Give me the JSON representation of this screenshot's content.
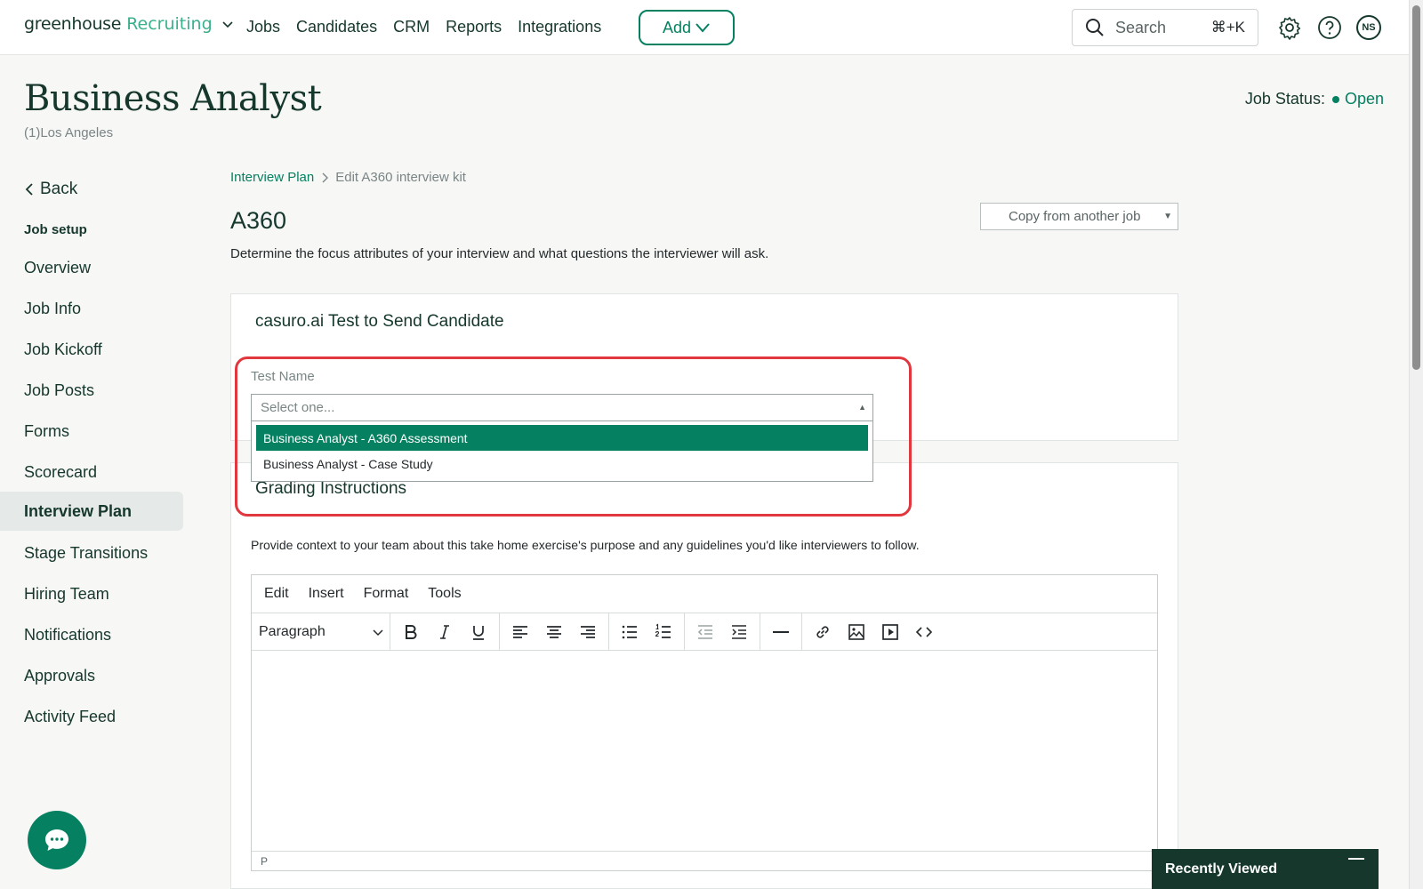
{
  "nav": {
    "brand_main": "greenhouse",
    "brand_sub": "Recruiting",
    "links": [
      "Jobs",
      "Candidates",
      "CRM",
      "Reports",
      "Integrations"
    ],
    "add_label": "Add",
    "search_placeholder": "Search",
    "search_shortcut": "⌘+K",
    "avatar_initials": "NS"
  },
  "header": {
    "title": "Business Analyst",
    "location": "(1)Los Angeles",
    "status_label": "Job Status:",
    "status_value": "Open"
  },
  "sidebar": {
    "back_label": "Back",
    "section_heading": "Job setup",
    "items": [
      {
        "label": "Overview"
      },
      {
        "label": "Job Info"
      },
      {
        "label": "Job Kickoff"
      },
      {
        "label": "Job Posts"
      },
      {
        "label": "Forms"
      },
      {
        "label": "Scorecard"
      },
      {
        "label": "Interview Plan"
      },
      {
        "label": "Stage Transitions"
      },
      {
        "label": "Hiring Team"
      },
      {
        "label": "Notifications"
      },
      {
        "label": "Approvals"
      },
      {
        "label": "Activity Feed"
      }
    ],
    "active_item": "Interview Plan"
  },
  "main": {
    "breadcrumb_link": "Interview Plan",
    "breadcrumb_current": "Edit A360 interview kit",
    "kit_title": "A360",
    "copy_select": "Copy from another job",
    "description": "Determine the focus attributes of your interview and what questions the interviewer will ask.",
    "test_card": {
      "heading": "casuro.ai Test to Send Candidate",
      "field_label": "Test Name",
      "placeholder": "Select one...",
      "options": [
        "Business Analyst - A360 Assessment",
        "Business Analyst - Case Study"
      ],
      "selected_option": "Business Analyst - A360 Assessment"
    },
    "grading": {
      "heading": "Grading Instructions",
      "text": "Provide context to your team about this take home exercise's purpose and any guidelines you'd like interviewers to follow."
    },
    "editor": {
      "menus": [
        "Edit",
        "Insert",
        "Format",
        "Tools"
      ],
      "block_format": "Paragraph",
      "status_path": "P"
    }
  },
  "footer": {
    "recently_viewed": "Recently Viewed"
  },
  "colors": {
    "brand_green": "#058060",
    "dark_green": "#15372c",
    "highlight_red": "#e0383e"
  }
}
